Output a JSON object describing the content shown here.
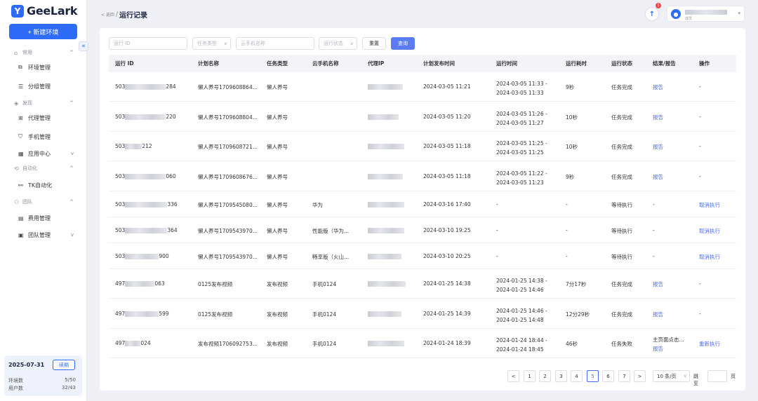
{
  "brand": {
    "logo_glyph": "Y",
    "name": "GeeLark"
  },
  "sidebar": {
    "new_env_label": "+ 新建环境",
    "collapse_glyph": "«",
    "groups": [
      {
        "label": "常用",
        "items": [
          {
            "label": "环境管理"
          },
          {
            "label": "分组管理"
          }
        ]
      },
      {
        "label": "发现",
        "items": [
          {
            "label": "代理管理"
          },
          {
            "label": "手机管理"
          },
          {
            "label": "应用中心"
          }
        ]
      },
      {
        "label": "自动化",
        "items": [
          {
            "label": "TK自动化"
          }
        ]
      },
      {
        "label": "团队",
        "items": [
          {
            "label": "费用管理"
          },
          {
            "label": "团队管理"
          }
        ]
      }
    ]
  },
  "account": {
    "expiry_date": "2025-07-31",
    "renew_label": "续期",
    "env_count_label": "环境数",
    "env_count_value": "5/50",
    "user_count_label": "用户数",
    "user_count_value": "32/43"
  },
  "header": {
    "back_label": "< 返回",
    "separator": "/",
    "title": "运行记录",
    "notification_count": "1",
    "user_role": "成员"
  },
  "filters": {
    "run_id_placeholder": "运行 ID",
    "task_type_placeholder": "任务类型",
    "phone_name_placeholder": "云手机名称",
    "run_status_placeholder": "运行状态",
    "reset_label": "重置",
    "query_label": "查询"
  },
  "table": {
    "columns": [
      "运行 ID",
      "计划名称",
      "任务类型",
      "云手机名称",
      "代理IP",
      "计划发布时间",
      "运行时间",
      "运行耗时",
      "运行状态",
      "结果/报告",
      "操作"
    ],
    "rows": [
      {
        "id_prefix": "503",
        "id_suffix": "284",
        "plan": "懒人养号1709608864...",
        "type": "懒人养号",
        "phone": "",
        "publish": "2024-03-05 11:21",
        "run_start": "2024-03-05 11:33 -",
        "run_end": "2024-03-05 11:33",
        "duration": "9秒",
        "status": "任务完成",
        "result": "报告",
        "result2": "",
        "action": "-"
      },
      {
        "id_prefix": "503",
        "id_suffix": "220",
        "plan": "懒人养号1709608804...",
        "type": "懒人养号",
        "phone": "",
        "publish": "2024-03-05 11:20",
        "run_start": "2024-03-05 11:26 -",
        "run_end": "2024-03-05 11:27",
        "duration": "10秒",
        "status": "任务完成",
        "result": "报告",
        "result2": "",
        "action": "-"
      },
      {
        "id_prefix": "503",
        "id_suffix": "212",
        "plan": "懒人养号1709608721...",
        "type": "懒人养号",
        "phone": "",
        "publish": "2024-03-05 11:18",
        "run_start": "2024-03-05 11:25 -",
        "run_end": "2024-03-05 11:25",
        "duration": "10秒",
        "status": "任务完成",
        "result": "报告",
        "result2": "",
        "action": "-"
      },
      {
        "id_prefix": "503",
        "id_suffix": "060",
        "plan": "懒人养号1709608676...",
        "type": "懒人养号",
        "phone": "",
        "publish": "2024-03-05 11:18",
        "run_start": "2024-03-05 11:22 -",
        "run_end": "2024-03-05 11:23",
        "duration": "9秒",
        "status": "任务完成",
        "result": "报告",
        "result2": "",
        "action": "-"
      },
      {
        "id_prefix": "503",
        "id_suffix": "336",
        "plan": "懒人养号1709545080...",
        "type": "懒人养号",
        "phone": "华为",
        "publish": "2024-03-16 17:40",
        "run_start": "-",
        "run_end": "",
        "duration": "-",
        "status": "等待执行",
        "result": "-",
        "result2": "",
        "action": "取消执行"
      },
      {
        "id_prefix": "503",
        "id_suffix": "364",
        "plan": "懒人养号1709543970...",
        "type": "懒人养号",
        "phone": "性能版（华为...",
        "publish": "2024-03-10 19:25",
        "run_start": "-",
        "run_end": "",
        "duration": "-",
        "status": "等待执行",
        "result": "-",
        "result2": "",
        "action": "取消执行"
      },
      {
        "id_prefix": "503",
        "id_suffix": "900",
        "plan": "懒人养号1709543970...",
        "type": "懒人养号",
        "phone": "畅享版（火山...",
        "publish": "2024-03-10 20:25",
        "run_start": "-",
        "run_end": "",
        "duration": "-",
        "status": "等待执行",
        "result": "-",
        "result2": "",
        "action": "取消执行"
      },
      {
        "id_prefix": "497",
        "id_suffix": "063",
        "plan": "0125发布视频",
        "type": "发布视频",
        "phone": "手机0124",
        "publish": "2024-01-25 14:38",
        "run_start": "2024-01-25 14:38 -",
        "run_end": "2024-01-25 14:46",
        "duration": "7分17秒",
        "status": "任务完成",
        "result": "报告",
        "result2": "",
        "action": "-"
      },
      {
        "id_prefix": "497",
        "id_suffix": "599",
        "plan": "0125发布视频",
        "type": "发布视频",
        "phone": "手机0124",
        "publish": "2024-01-25 14:39",
        "run_start": "2024-01-25 14:46 -",
        "run_end": "2024-01-25 14:48",
        "duration": "12分29秒",
        "status": "任务完成",
        "result": "报告",
        "result2": "",
        "action": "-"
      },
      {
        "id_prefix": "497",
        "id_suffix": "024",
        "plan": "发布视频1706092753...",
        "type": "发布视频",
        "phone": "手机0124",
        "publish": "2024-01-24 18:39",
        "run_start": "2024-01-24 18:44 -",
        "run_end": "2024-01-24 18:45",
        "duration": "46秒",
        "status": "任务失败",
        "result": "主页面点击...",
        "result2": "报告",
        "action": "重新执行"
      }
    ]
  },
  "pagination": {
    "prev": "<",
    "pages": [
      "1",
      "2",
      "3",
      "4",
      "5",
      "6",
      "7"
    ],
    "active_page": "5",
    "next": ">",
    "page_size": "10 条/页",
    "goto_label": "跳至",
    "page_suffix": "页"
  }
}
